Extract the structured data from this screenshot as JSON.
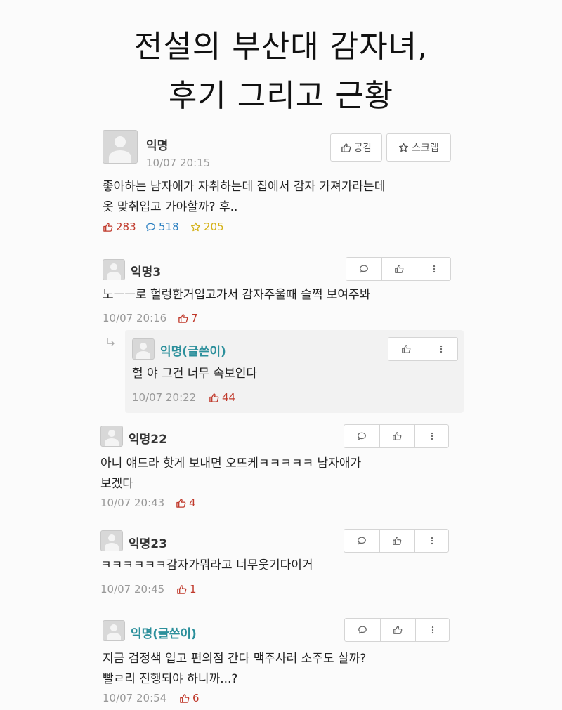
{
  "headline": {
    "line1": "전설의 부산대 감자녀,",
    "line2": "후기 그리고 근황"
  },
  "post": {
    "author": "익명",
    "time": "10/07 20:15",
    "empathy_label": "공감",
    "scrap_label": "스크랩",
    "body_line1": "좋아하는 남자애가 자취하는데 집에서 감자 가져가라는데",
    "body_line2": "옷 맞춰입고 가야할까? 후..",
    "likes": "283",
    "comments": "518",
    "scraps": "205"
  },
  "comments": [
    {
      "author": "익명3",
      "text": "노ㅡㅡ로 헐렁한거입고가서 감자주울때 슬쩍 보여주봐",
      "time": "10/07 20:16",
      "likes": "7"
    },
    {
      "author": "익명(글쓴이)",
      "text": "헐 야 그건 너무 속보인다",
      "time": "10/07 20:22",
      "likes": "44"
    },
    {
      "author": "익명22",
      "text_line1": "아니 얘드라 핫게 보내면 오뜨케ㅋㅋㅋㅋㅋ 남자애가",
      "text_line2": "보겠다",
      "time": "10/07 20:43",
      "likes": "4"
    },
    {
      "author": "익명23",
      "text": "ㅋㅋㅋㅋㅋㅋ감자가뭐라고 너무웃기다이거",
      "time": "10/07 20:45",
      "likes": "1"
    },
    {
      "author": "익명(글쓴이)",
      "text_line1": "지금 검정색 입고 편의점 간다 맥주사러 소주도 살까?",
      "text_line2": "빨ㄹ리 진행되야 하니까...?",
      "time": "10/07 20:54",
      "likes": "6"
    }
  ],
  "colors": {
    "like": "#c0392b",
    "comment": "#2a7fc1",
    "scrap": "#d4b21a",
    "author_name": "#2b8f9b"
  },
  "icons": [
    "thumbs-up-icon",
    "star-icon",
    "comment-bubble-icon",
    "more-vertical-icon",
    "reply-arrow-icon",
    "avatar-icon"
  ]
}
